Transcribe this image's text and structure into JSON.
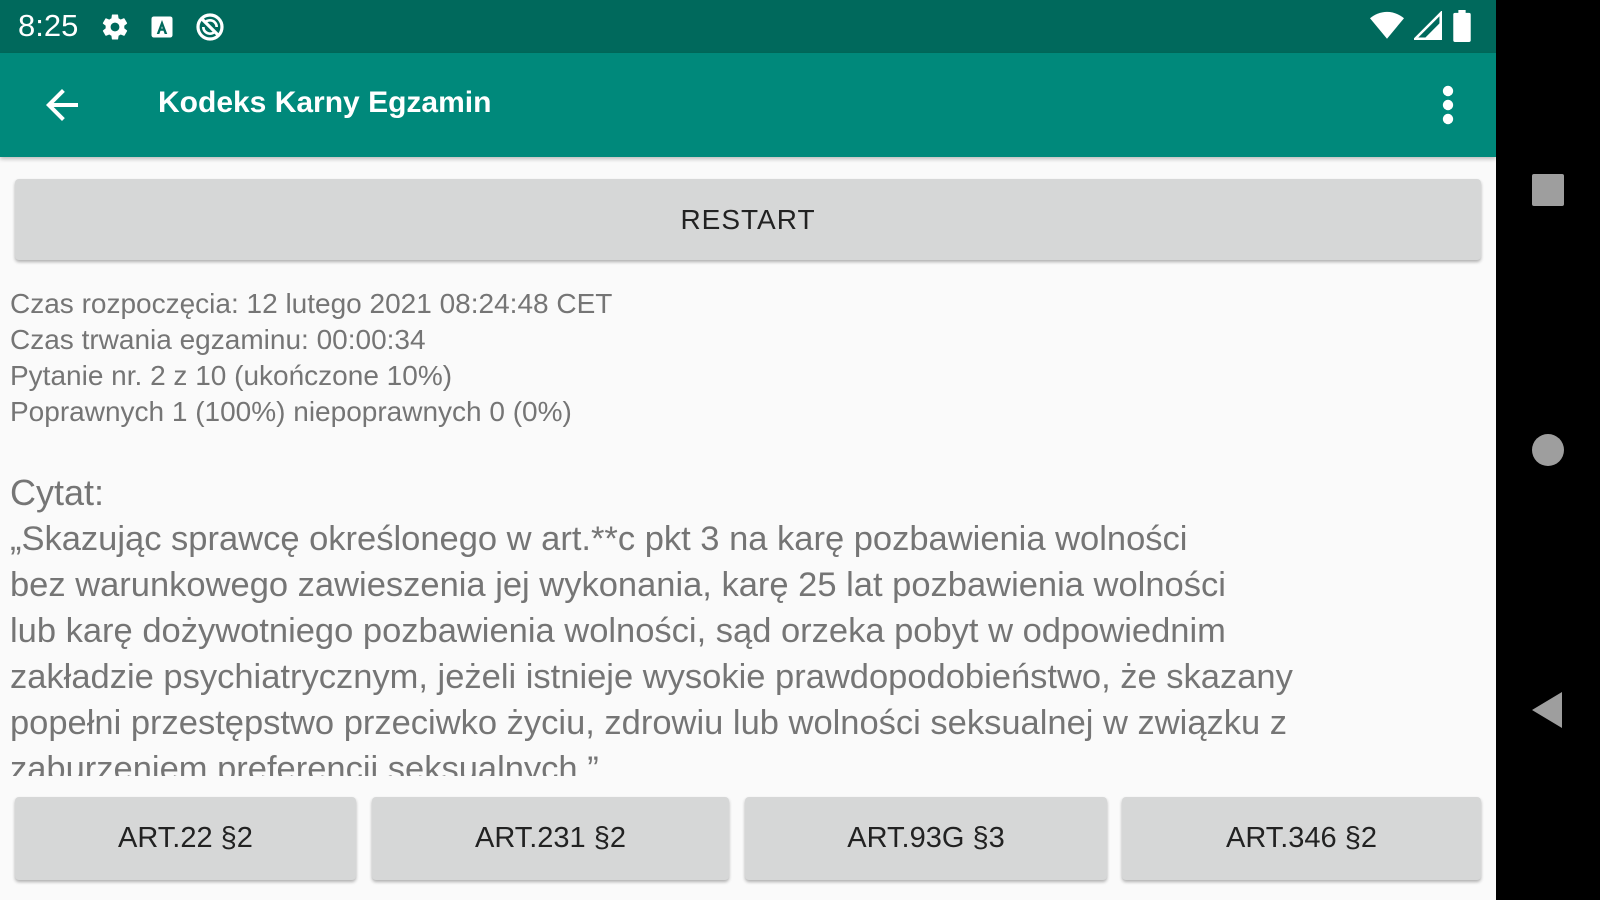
{
  "status_bar": {
    "time": "8:25"
  },
  "app_bar": {
    "title": "Kodeks Karny Egzamin"
  },
  "restart": {
    "label": "RESTART"
  },
  "stats": {
    "start_time": "Czas rozpoczęcia: 12 lutego 2021 08:24:48 CET",
    "duration": "Czas trwania egzaminu: 00:00:34",
    "question": "Pytanie nr. 2 z 10 (ukończone 10%)",
    "score": "Poprawnych 1 (100%) niepoprawnych 0 (0%)"
  },
  "quote": {
    "label": "Cytat:",
    "text": "„Skazując sprawcę określonego w art.**c pkt 3 na karę pozbawienia wolności\nbez warunkowego zawieszenia jej wykonania, karę 25 lat pozbawienia wolności\nlub karę dożywotniego pozbawienia wolności, sąd orzeka pobyt w odpowiednim\nzakładzie psychiatrycznym, jeżeli istnieje wysokie prawdopodobieństwo, że skazany\npopełni przestępstwo przeciwko życiu, zdrowiu lub wolności seksualnej w związku z\nzaburzeniem preferencji seksualnych.”"
  },
  "answers": [
    {
      "label": "ART.22 §2"
    },
    {
      "label": "ART.231 §2"
    },
    {
      "label": "ART.93G §3"
    },
    {
      "label": "ART.346 §2"
    }
  ],
  "colors": {
    "status_bar": "#00695c",
    "app_bar": "#00897b",
    "button": "#d6d7d7",
    "text_secondary": "#757575"
  },
  "icons": {
    "status_left": [
      "gear-icon",
      "a-box-icon",
      "no-sync-icon"
    ],
    "status_right": [
      "wifi-icon",
      "signal-icon",
      "battery-icon"
    ],
    "app_bar": [
      "back-arrow-icon",
      "more-vert-icon"
    ],
    "nav": [
      "recents-icon",
      "home-icon",
      "back-icon"
    ]
  }
}
